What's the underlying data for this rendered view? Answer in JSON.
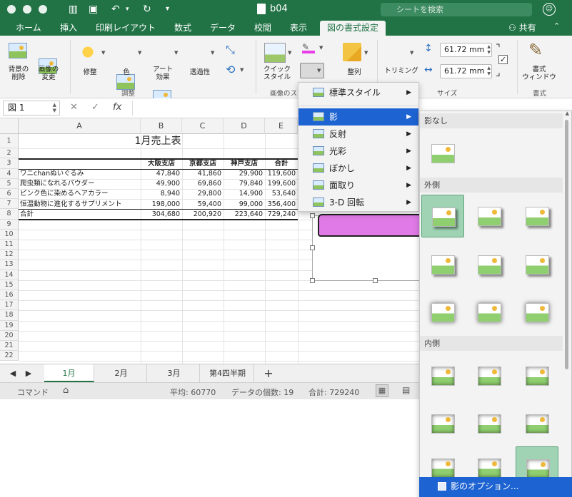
{
  "window": {
    "title": "b04",
    "search_placeholder": "シートを検索"
  },
  "tabs": [
    "ホーム",
    "挿入",
    "印刷レイアウト",
    "数式",
    "データ",
    "校閲",
    "表示",
    "図の書式設定"
  ],
  "share_label": "共有",
  "ribbon": {
    "bg_remove": "背景の\n削除",
    "change_pic": "画像の\n変更",
    "corrections": "修整",
    "color": "色",
    "art_effects": "アート\n効果",
    "transparency": "透過性",
    "group_adjust": "調整",
    "quick_styles": "クイック\nスタイル",
    "group_styles": "画像のス",
    "arrange": "整列",
    "trim": "トリミング",
    "height": "61.72 mm",
    "width": "61.72 mm",
    "group_size": "サイズ",
    "format_pane": "書式\nウィンドウ",
    "group_format": "書式"
  },
  "formula_bar": {
    "name_box": "図 1",
    "fx": "fx"
  },
  "columns": [
    "A",
    "B",
    "C",
    "D",
    "E"
  ],
  "rows": [
    "1",
    "2",
    "3",
    "4",
    "5",
    "6",
    "7",
    "8",
    "9",
    "10",
    "11",
    "12",
    "13",
    "14",
    "15",
    "16",
    "17",
    "18",
    "19",
    "20",
    "21",
    "22"
  ],
  "sheet": {
    "title": "1月売上表",
    "headers": [
      "大阪支店",
      "京都支店",
      "神戸支店",
      "合計"
    ],
    "data": [
      {
        "name": "ワニchanぬいぐるみ",
        "v": [
          "47,840",
          "41,860",
          "29,900",
          "119,600"
        ]
      },
      {
        "name": "爬虫類になれるパウダー",
        "v": [
          "49,900",
          "69,860",
          "79,840",
          "199,600"
        ]
      },
      {
        "name": "ピンク色に染めるヘアカラー",
        "v": [
          "8,940",
          "29,800",
          "14,900",
          "53,640"
        ]
      },
      {
        "name": "恒温動物に進化するサプリメント",
        "v": [
          "198,000",
          "59,400",
          "99,000",
          "356,400"
        ]
      },
      {
        "name": "合計",
        "v": [
          "304,680",
          "200,920",
          "223,640",
          "729,240"
        ]
      }
    ]
  },
  "sheet_tabs": [
    "1月",
    "2月",
    "3月",
    "第4四半期"
  ],
  "status": {
    "mode": "コマンド",
    "average": "平均: 60770",
    "count": "データの個数: 19",
    "sum": "合計: 729240"
  },
  "menu": {
    "items": [
      "標準スタイル",
      "影",
      "反射",
      "光彩",
      "ぼかし",
      "面取り",
      "3-D 回転"
    ],
    "highlighted": "影"
  },
  "gallery": {
    "sections": [
      "影なし",
      "外側",
      "内側"
    ],
    "options_label": "影のオプション..."
  },
  "colors": {
    "brand": "#217346",
    "menu_highlight": "#1d63d1",
    "gallery_selected": "#9fd3b4"
  }
}
